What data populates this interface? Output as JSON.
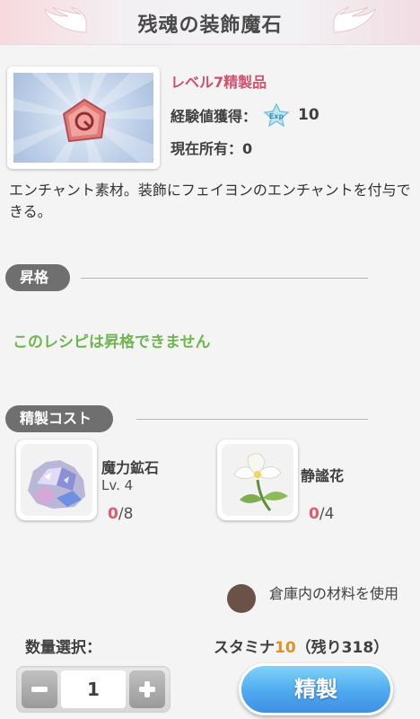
{
  "header": {
    "title": "残魂の装飾魔石"
  },
  "item": {
    "level_text": "レベル7精製品",
    "exp_label": "経験値獲得：",
    "exp_value": "10",
    "owned_text": "現在所有：0",
    "description": "エンチャント素材。装飾にフェイヨンのエンチャントを付与できる。"
  },
  "upgrade_section": {
    "title": "昇格",
    "message": "このレシピは昇格できません"
  },
  "cost_section": {
    "title": "精製コスト",
    "materials": [
      {
        "name": "魔力鉱石",
        "level": "Lv. 4",
        "have": "0",
        "need": "/8",
        "icon": "crystal-ore-icon"
      },
      {
        "name": "静謐花",
        "level": "",
        "have": "0",
        "need": "/4",
        "icon": "white-flower-icon"
      }
    ]
  },
  "storage": {
    "label": "倉庫内の材料を使用"
  },
  "quantity": {
    "label": "数量選択：",
    "value": "1"
  },
  "stamina": {
    "prefix": "スタミナ",
    "cost": "10",
    "remaining": "（残り318）"
  },
  "refine_button": {
    "label": "精製"
  },
  "colors": {
    "accent_pink": "#d0506e",
    "success_green": "#6fb550",
    "button_blue": "#4fa9ef",
    "stamina_orange": "#e3902b"
  }
}
